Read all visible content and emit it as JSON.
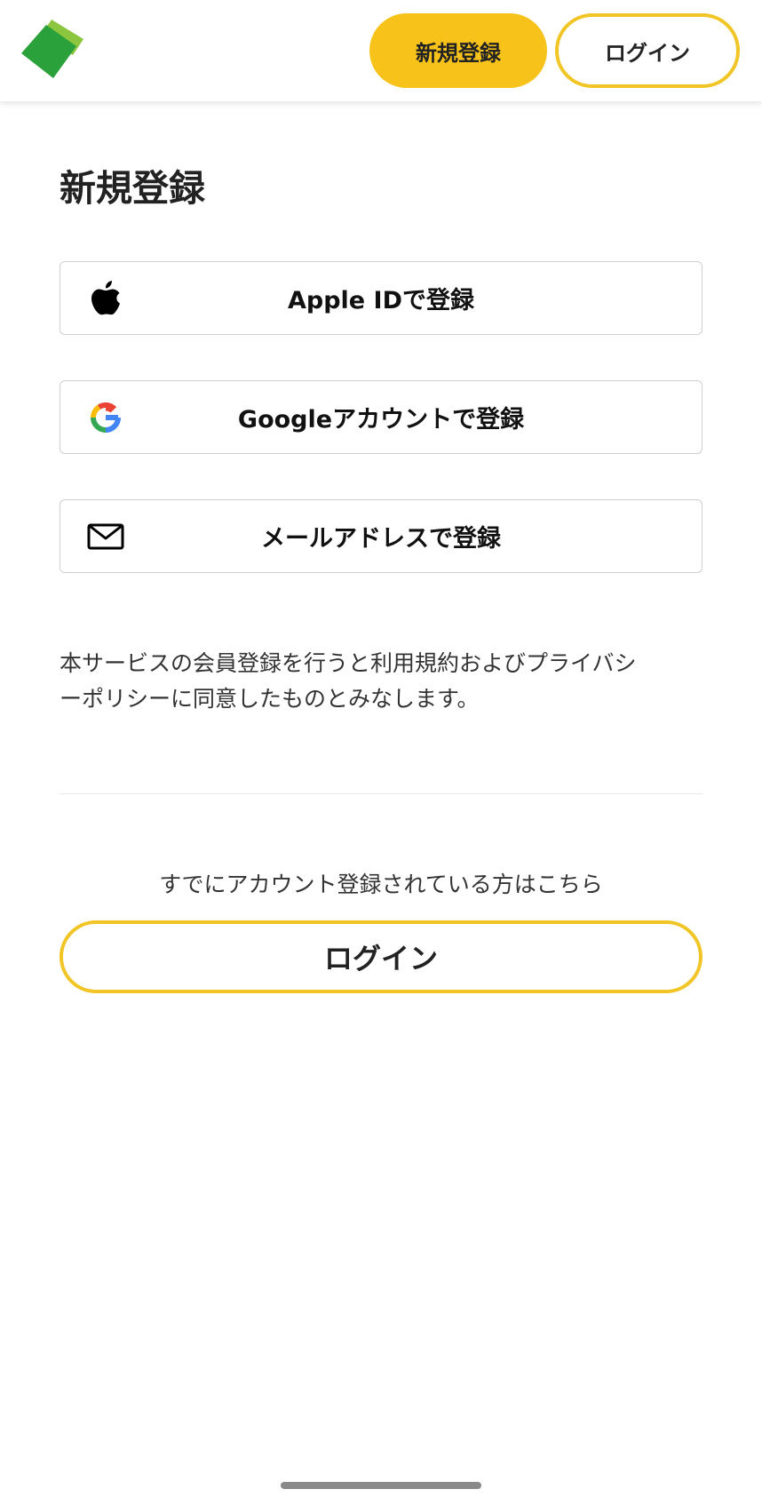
{
  "header": {
    "signup_label": "新規登録",
    "login_label": "ログイン"
  },
  "main": {
    "title": "新規登録",
    "auth_buttons": [
      {
        "label": "Apple IDで登録",
        "icon": "apple-icon"
      },
      {
        "label": "Googleアカウントで登録",
        "icon": "google-icon"
      },
      {
        "label": "メールアドレスで登録",
        "icon": "mail-icon"
      }
    ],
    "terms_line1": "本サービスの会員登録を行うと利用規約およびプライバシ",
    "terms_line2": "ーポリシーに同意したものとみなします。",
    "already_text": "すでにアカウント登録されている方はこちら",
    "login_button_label": "ログイン"
  },
  "colors": {
    "accent_yellow": "#f7c31b",
    "logo_green_dark": "#2a9d3a",
    "logo_green_light": "#8cc63f"
  }
}
